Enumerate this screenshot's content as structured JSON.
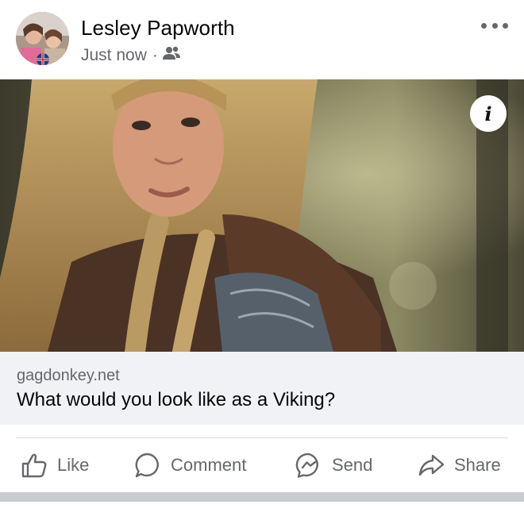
{
  "post": {
    "author": "Lesley Papworth",
    "timestamp": "Just now",
    "separator": "·",
    "audience_icon": "friends-icon",
    "more_icon": "more-options-icon"
  },
  "link": {
    "domain": "gagdonkey.net",
    "headline": "What would you look like as a Viking?",
    "info_label": "i"
  },
  "actions": [
    {
      "label": "Like",
      "icon": "like-icon"
    },
    {
      "label": "Comment",
      "icon": "comment-icon"
    },
    {
      "label": "Send",
      "icon": "messenger-icon"
    },
    {
      "label": "Share",
      "icon": "share-icon"
    }
  ],
  "colors": {
    "text_primary": "#050505",
    "text_secondary": "#65676b",
    "preview_bg": "#f0f2f5",
    "divider": "#dadde1"
  }
}
